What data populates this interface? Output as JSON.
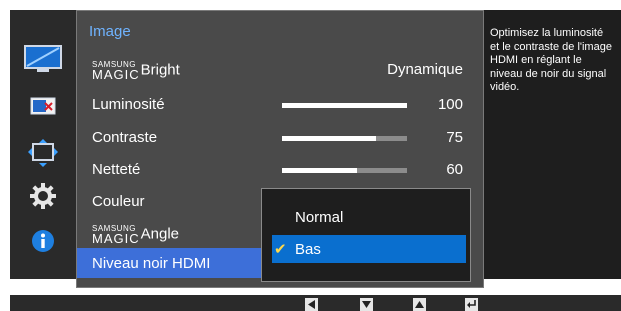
{
  "menu": {
    "title": "Image",
    "rows": [
      {
        "magic_top": "SAMSUNG",
        "magic_bottom": "MAGIC",
        "label": "Bright",
        "value": "Dynamique"
      },
      {
        "label": "Luminosité",
        "value": "100",
        "level": 1.0
      },
      {
        "label": "Contraste",
        "value": "75",
        "level": 0.75
      },
      {
        "label": "Netteté",
        "value": "60",
        "level": 0.6
      },
      {
        "label": "Couleur"
      },
      {
        "magic_top": "SAMSUNG",
        "magic_bottom": "MAGIC",
        "label": "Angle"
      },
      {
        "label": "Niveau noir HDMI"
      }
    ]
  },
  "popup": {
    "options": [
      {
        "label": "Normal"
      },
      {
        "label": "Bas",
        "checked": true
      }
    ]
  },
  "help_text": "Optimisez la luminosité et le contraste de l'image HDMI en réglant le niveau de noir du signal vidéo.",
  "sidebar_icons": [
    "picture-icon",
    "screen-adjust-icon",
    "position-icon",
    "settings-gear-icon",
    "information-icon"
  ],
  "nav_buttons": [
    "left-arrow-button",
    "down-arrow-button",
    "up-arrow-button",
    "enter-button"
  ],
  "colors": {
    "accent": "#6fb3ff",
    "selected_row": "#3d6fd9",
    "selected_option": "#0a6fcf",
    "check": "#ffd84a"
  }
}
